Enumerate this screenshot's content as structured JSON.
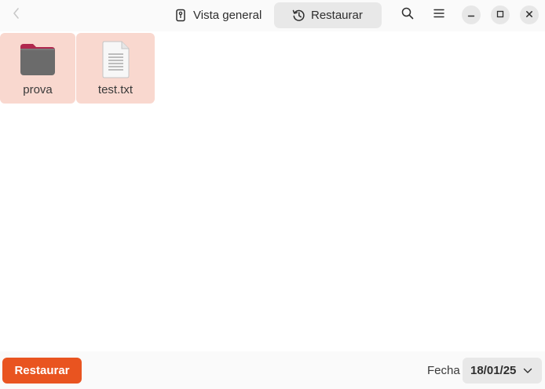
{
  "header": {
    "back_icon": "chevron-left-icon",
    "views": [
      {
        "label": "Vista general",
        "icon": "drive-icon",
        "active": false
      },
      {
        "label": "Restaurar",
        "icon": "history-icon",
        "active": true
      }
    ],
    "search_icon": "search-icon",
    "menu_icon": "hamburger-menu-icon",
    "window_controls": [
      "minimize-icon",
      "maximize-icon",
      "close-icon"
    ]
  },
  "files": [
    {
      "name": "prova",
      "type": "folder",
      "icon": "folder-icon"
    },
    {
      "name": "test.txt",
      "type": "text",
      "icon": "text-file-icon"
    }
  ],
  "footer": {
    "restore_label": "Restaurar",
    "date_label": "Fecha",
    "date_value": "18/01/25"
  },
  "colors": {
    "accent": "#e95420",
    "selection": "#f9d8cf",
    "folder": "#6b6b6b",
    "folder_tab": "#b0284e"
  }
}
